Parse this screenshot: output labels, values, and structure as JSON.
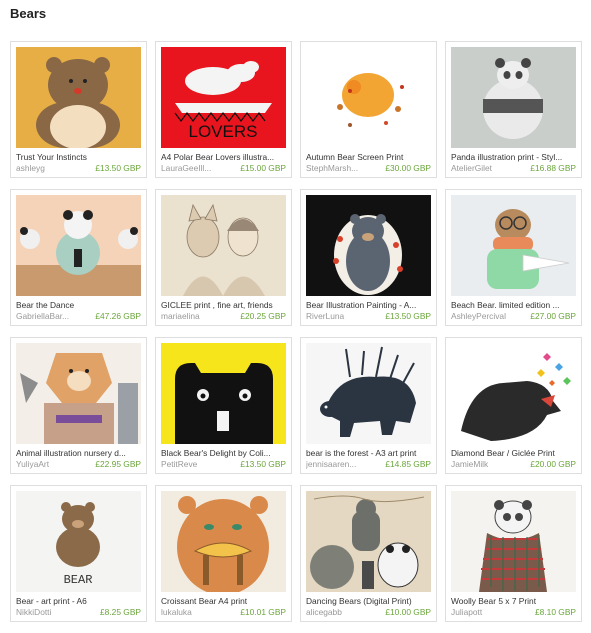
{
  "section": {
    "title": "Bears"
  },
  "items": [
    {
      "title": "Trust Your Instincts",
      "shop": "ashleyg",
      "price": "£13.50 GBP"
    },
    {
      "title": "A4 Polar Bear Lovers illustra...",
      "shop": "LauraGeeIll...",
      "price": "£15.00 GBP"
    },
    {
      "title": "Autumn Bear Screen Print",
      "shop": "StephMarsh...",
      "price": "£30.00 GBP"
    },
    {
      "title": "Panda illustration print - Styl...",
      "shop": "AtelierGilet",
      "price": "£16.88 GBP"
    },
    {
      "title": "Bear the Dance",
      "shop": "GabriellaBar...",
      "price": "£47.26 GBP"
    },
    {
      "title": "GICLEE print , fine art, friends",
      "shop": "mariaelina",
      "price": "£20.25 GBP"
    },
    {
      "title": "Bear Illustration Painting - A...",
      "shop": "RiverLuna",
      "price": "£13.50 GBP"
    },
    {
      "title": "Beach Bear. limited edition ...",
      "shop": "AshleyPercival",
      "price": "£27.00 GBP"
    },
    {
      "title": "Animal illustration nursery d...",
      "shop": "YuliyaArt",
      "price": "£22.95 GBP"
    },
    {
      "title": "Black Bear's Delight by Coli...",
      "shop": "PetitReve",
      "price": "£13.50 GBP"
    },
    {
      "title": "bear is the forest - A3 art print",
      "shop": "jennisaaren...",
      "price": "£14.85 GBP"
    },
    {
      "title": "Diamond Bear / Giclée Print",
      "shop": "JamieMilk",
      "price": "£20.00 GBP"
    },
    {
      "title": "Bear - art print - A6",
      "shop": "NikkiDotti",
      "price": "£8.25 GBP"
    },
    {
      "title": "Croissant Bear A4 print",
      "shop": "lukaluka",
      "price": "£10.01 GBP"
    },
    {
      "title": "Dancing Bears (Digital Print)",
      "shop": "alicegabb",
      "price": "£10.00 GBP"
    },
    {
      "title": "Woolly Bear 5 x 7 Print",
      "shop": "Juliapott",
      "price": "£8.10 GBP"
    }
  ],
  "artwork_text": {
    "lovers": "LOVERS",
    "bear": "BEAR"
  }
}
